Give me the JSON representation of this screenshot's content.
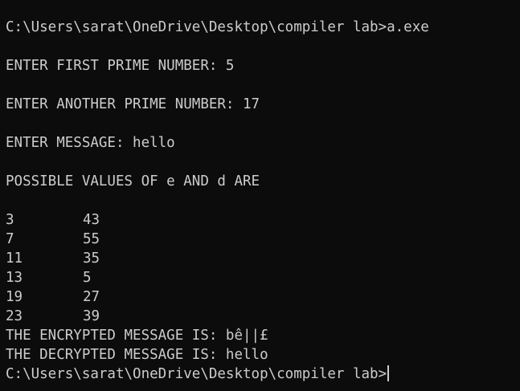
{
  "terminal": {
    "prompt_command": "C:\\Users\\sarat\\OneDrive\\Desktop\\compiler lab>a.exe",
    "first_prime_label": "ENTER FIRST PRIME NUMBER: 5",
    "second_prime_label": "ENTER ANOTHER PRIME NUMBER: 17",
    "message_label": "ENTER MESSAGE: hello",
    "values_header": "POSSIBLE VALUES OF e AND d ARE",
    "pairs": [
      {
        "e": "3",
        "d": "43"
      },
      {
        "e": "7",
        "d": "55"
      },
      {
        "e": "11",
        "d": "35"
      },
      {
        "e": "13",
        "d": "5"
      },
      {
        "e": "19",
        "d": "27"
      },
      {
        "e": "23",
        "d": "39"
      }
    ],
    "encrypted_line": "THE ENCRYPTED MESSAGE IS: bê||£",
    "decrypted_line": "THE DECRYPTED MESSAGE IS: hello",
    "final_prompt": "C:\\Users\\sarat\\OneDrive\\Desktop\\compiler lab>"
  },
  "colors": {
    "background": "#0c0c0c",
    "foreground": "#cccccc"
  }
}
